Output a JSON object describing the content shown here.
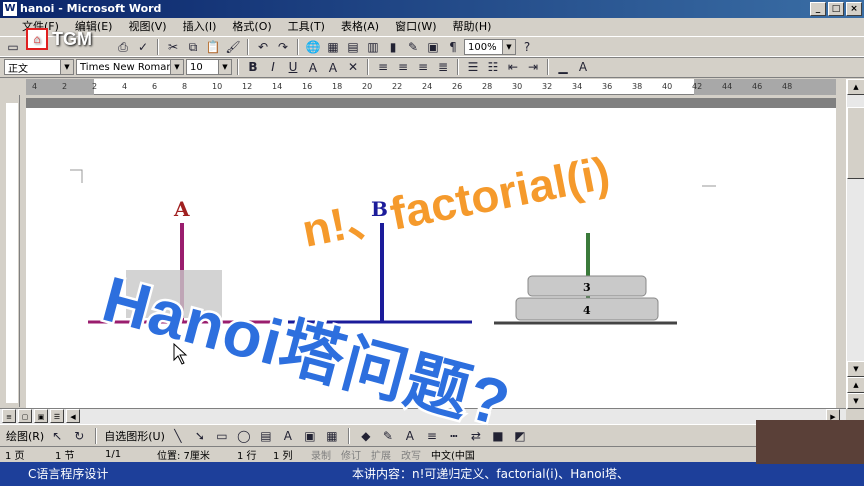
{
  "window": {
    "title": "hanoi - Microsoft Word",
    "icon": "word-icon",
    "buttons": [
      "_",
      "□",
      "×"
    ]
  },
  "menu": [
    "文件(F)",
    "编辑(E)",
    "视图(V)",
    "插入(I)",
    "格式(O)",
    "工具(T)",
    "表格(A)",
    "窗口(W)",
    "帮助(H)"
  ],
  "logo": {
    "text": "TGM"
  },
  "toolbar": {
    "zoom": "100%"
  },
  "format_toolbar": {
    "style": "正文",
    "font": "Times New Roman",
    "size": "10",
    "bold": "B",
    "italic": "I",
    "underline": "U"
  },
  "ruler": {
    "ticks": [
      "4",
      "2",
      "2",
      "4",
      "6",
      "8",
      "10",
      "12",
      "14",
      "16",
      "18",
      "20",
      "22",
      "24",
      "26",
      "28",
      "30",
      "32",
      "34",
      "36",
      "38",
      "40",
      "42",
      "44",
      "46",
      "48"
    ]
  },
  "drawing_toolbar": {
    "draw": "绘图(R)",
    "autoshapes": "自选图形(U)"
  },
  "diagram": {
    "peg_a": "A",
    "peg_b": "B",
    "disk_3": "3",
    "disk_4": "4"
  },
  "status": {
    "page": "1 页",
    "section": "1 节",
    "pages": "1/1",
    "position": "位置: 7厘米",
    "line": "1 行",
    "column": "1 列",
    "rec": "录制",
    "track": "修订",
    "ext": "扩展",
    "ovr": "改写",
    "lang": "中文(中国"
  },
  "overlay": {
    "factorial": "n!、factorial(i)",
    "hanoi": "Hanoi塔问题?"
  },
  "caption": {
    "course": "C语言程序设计",
    "content": "本讲内容：n!可递归定义、factorial(i)、Hanoi塔、"
  },
  "colors": {
    "title_bar": "#0a246a",
    "caption_bg": "#1d3f9a",
    "overlay_orange": "#f59a2c",
    "overlay_blue": "#2d6fde",
    "peg_a": "#9a1d6e",
    "peg_b": "#1b1b9a"
  }
}
